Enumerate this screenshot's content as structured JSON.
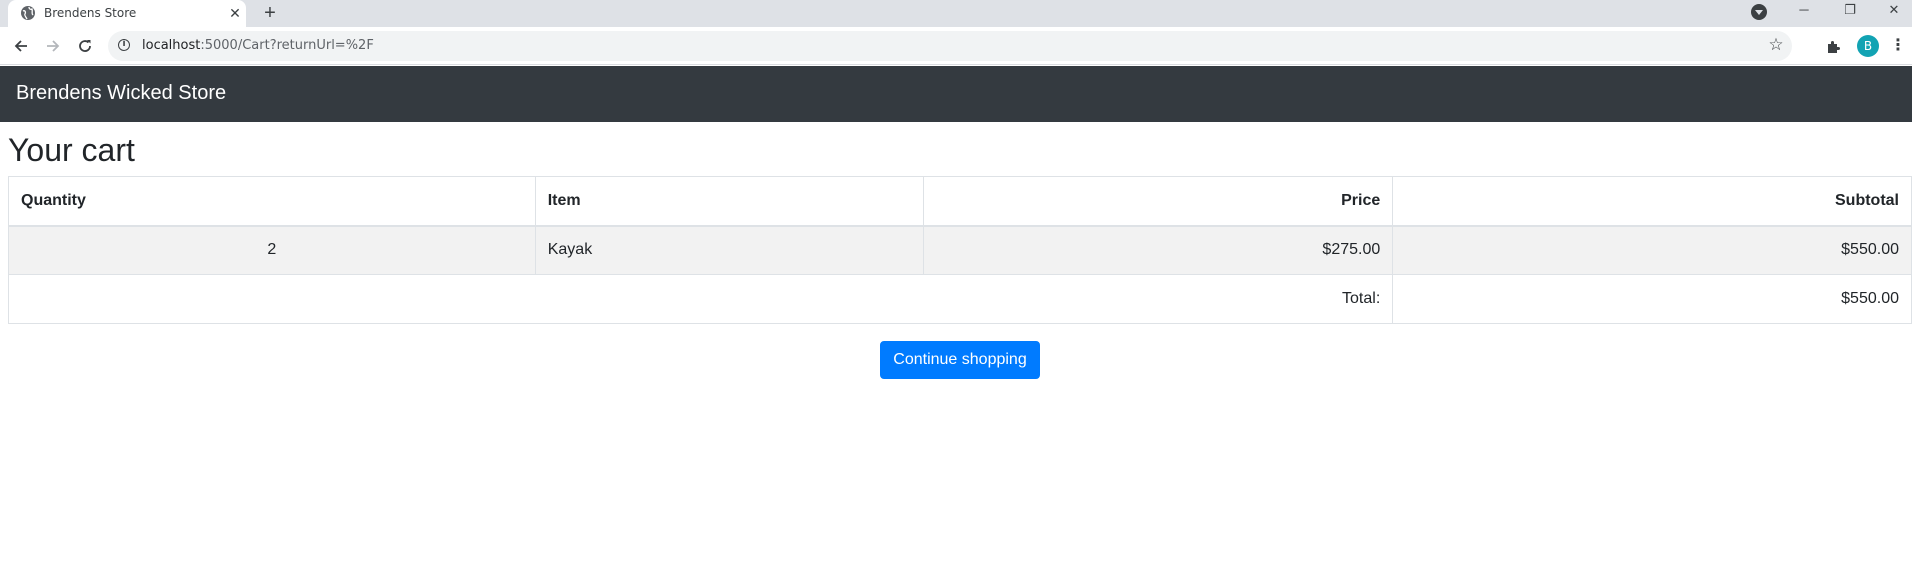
{
  "browser": {
    "tab_title": "Brendens Store",
    "new_tab_symbol": "+",
    "url_host": "localhost",
    "url_path": ":5000/Cart?returnUrl=%2F",
    "profile_initial": "B",
    "icons": {
      "favicon": "globe-icon",
      "close": "close-icon",
      "back": "back-arrow-icon",
      "forward": "forward-arrow-icon",
      "reload": "reload-icon",
      "info": "info-icon",
      "bookmark": "star-icon",
      "extensions": "puzzle-icon",
      "menu": "kebab-menu-icon"
    }
  },
  "navbar": {
    "brand": "Brendens Wicked Store",
    "background": "#343a40"
  },
  "page": {
    "title": "Your cart"
  },
  "cart": {
    "headers": {
      "quantity": "Quantity",
      "item": "Item",
      "price": "Price",
      "subtotal": "Subtotal"
    },
    "rows": [
      {
        "quantity": "2",
        "item": "Kayak",
        "price": "$275.00",
        "subtotal": "$550.00"
      }
    ],
    "total_label": "Total:",
    "total_value": "$550.00"
  },
  "actions": {
    "continue_label": "Continue shopping",
    "accent": "#007bff"
  }
}
